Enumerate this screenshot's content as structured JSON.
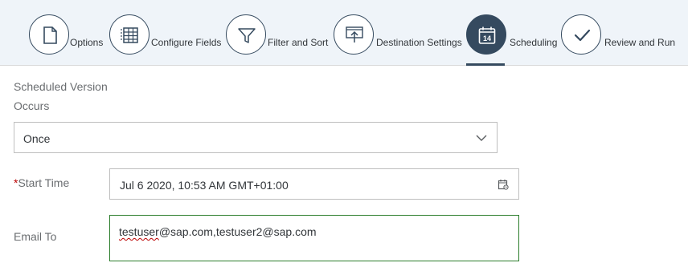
{
  "wizard": {
    "steps": [
      {
        "label": "Options",
        "icon": "document-icon"
      },
      {
        "label": "Configure Fields",
        "icon": "table-icon"
      },
      {
        "label": "Filter and Sort",
        "icon": "filter-icon"
      },
      {
        "label": "Destination Settings",
        "icon": "upload-board-icon"
      },
      {
        "label": "Scheduling",
        "icon": "calendar-icon",
        "icon_text": "14",
        "active": true
      },
      {
        "label": "Review and Run",
        "icon": "checkmark-icon"
      }
    ]
  },
  "form": {
    "section_title": "Scheduled Version",
    "occurs_label": "Occurs",
    "occurs_value": "Once",
    "start_time_required_mark": "*",
    "start_time_label": "Start Time",
    "start_time_value": "Jul 6 2020, 10:53 AM GMT+01:00",
    "email_label": "Email To",
    "email_misspelled_part": "testuser",
    "email_rest": "@sap.com,testuser2@sap.com"
  },
  "colors": {
    "accent": "#354a5f",
    "header_bg": "#eff4f9",
    "required": "#bb0000",
    "valid_border": "#2b7d2b"
  }
}
